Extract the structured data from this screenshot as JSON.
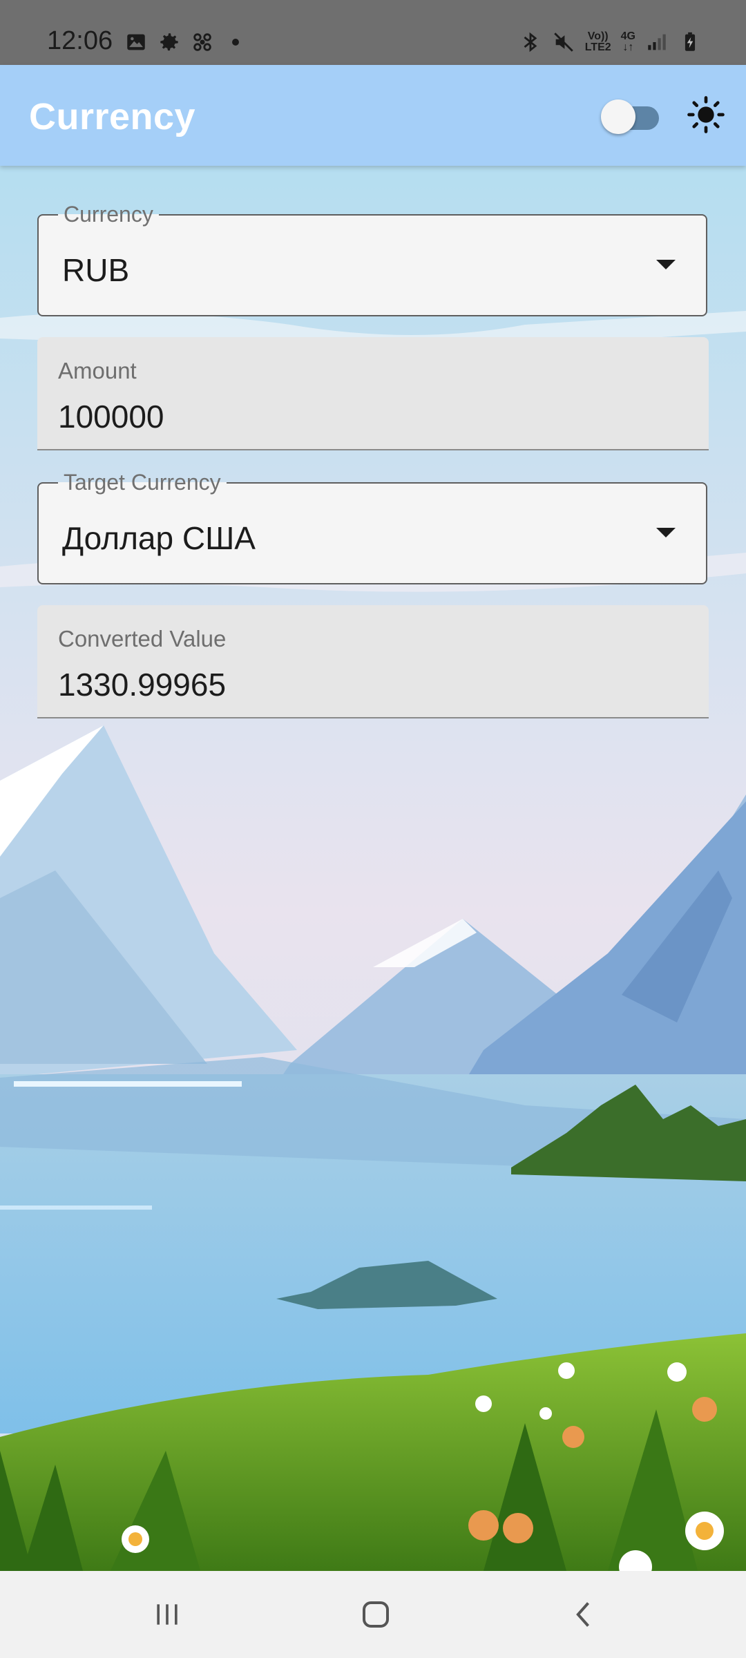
{
  "status_bar": {
    "time": "12:06",
    "network_top": "Vo))",
    "network_bottom": "LTE2",
    "data_type": "4G",
    "left_icons": [
      "image-icon",
      "gear-icon",
      "fan-icon",
      "dot-icon"
    ],
    "right_icons": [
      "bluetooth-icon",
      "mute-icon",
      "signal-icon",
      "battery-charging-icon"
    ]
  },
  "app_bar": {
    "title": "Currency",
    "theme_toggle": {
      "on": false
    },
    "theme_icon": "sun-icon",
    "color": "#a5cff8"
  },
  "form": {
    "currency": {
      "label": "Currency",
      "value": "RUB"
    },
    "amount": {
      "label": "Amount",
      "value": "100000"
    },
    "target_currency": {
      "label": "Target Currency",
      "value": "Доллар США"
    },
    "converted_value": {
      "label": "Converted Value",
      "value": "1330.99965"
    }
  },
  "nav_bar": {
    "buttons": [
      "recent-apps-icon",
      "home-icon",
      "back-icon"
    ]
  }
}
